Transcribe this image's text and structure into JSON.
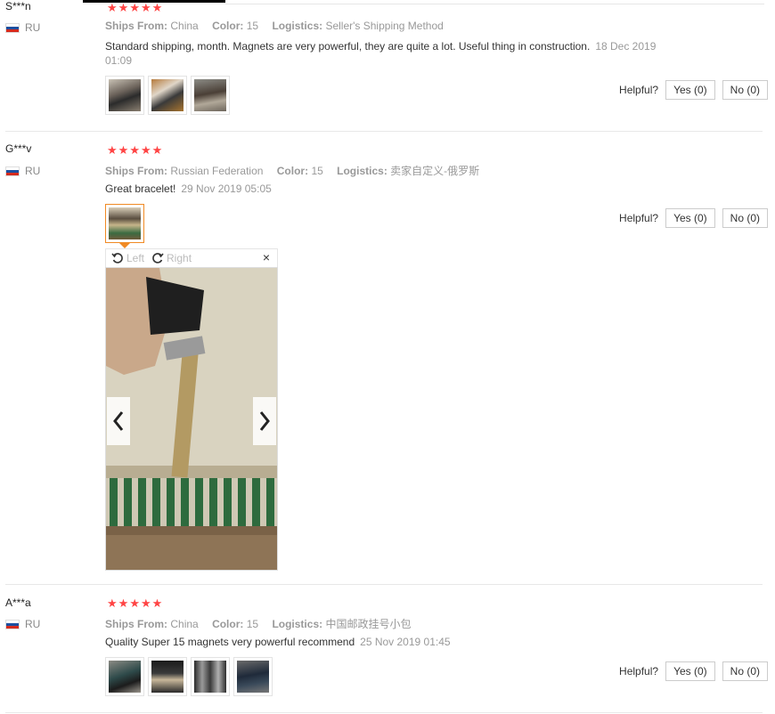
{
  "labels": {
    "ships_from": "Ships From:",
    "color": "Color:",
    "logistics": "Logistics:",
    "helpful": "Helpful?"
  },
  "reviews": [
    {
      "name": "S***n",
      "country": "RU",
      "stars": 5,
      "ships_from": "China",
      "color": "15",
      "logistics": "Seller's Shipping Method",
      "text": "Standard shipping, month. Magnets are very powerful, they are quite a lot. Useful thing in construction.",
      "date": "18 Dec 2019 01:09",
      "yes": "Yes (0)",
      "no": "No (0)"
    },
    {
      "name": "G***v",
      "country": "RU",
      "stars": 5,
      "ships_from": "Russian Federation",
      "color": "15",
      "logistics": "卖家自定义-俄罗斯",
      "text": "Great bracelet!",
      "date": "29 Nov 2019 05:05",
      "yes": "Yes (0)",
      "no": "No (0)"
    },
    {
      "name": "A***a",
      "country": "RU",
      "stars": 5,
      "ships_from": "China",
      "color": "15",
      "logistics": "中国邮政挂号小包",
      "text": "Quality Super 15 magnets very powerful recommend",
      "date": "25 Nov 2019 01:45",
      "yes": "Yes (0)",
      "no": "No (0)"
    }
  ],
  "viewer": {
    "rotate_left": "Left",
    "rotate_right": "Right",
    "close": "×"
  },
  "colors": {
    "star": "#ff4444",
    "selected_border": "#f08a24",
    "muted_text": "#999999"
  },
  "icons": [
    "star-icon",
    "ru-flag-icon",
    "rotate-left-icon",
    "rotate-right-icon",
    "close-icon",
    "chevron-left-icon",
    "chevron-right-icon"
  ]
}
